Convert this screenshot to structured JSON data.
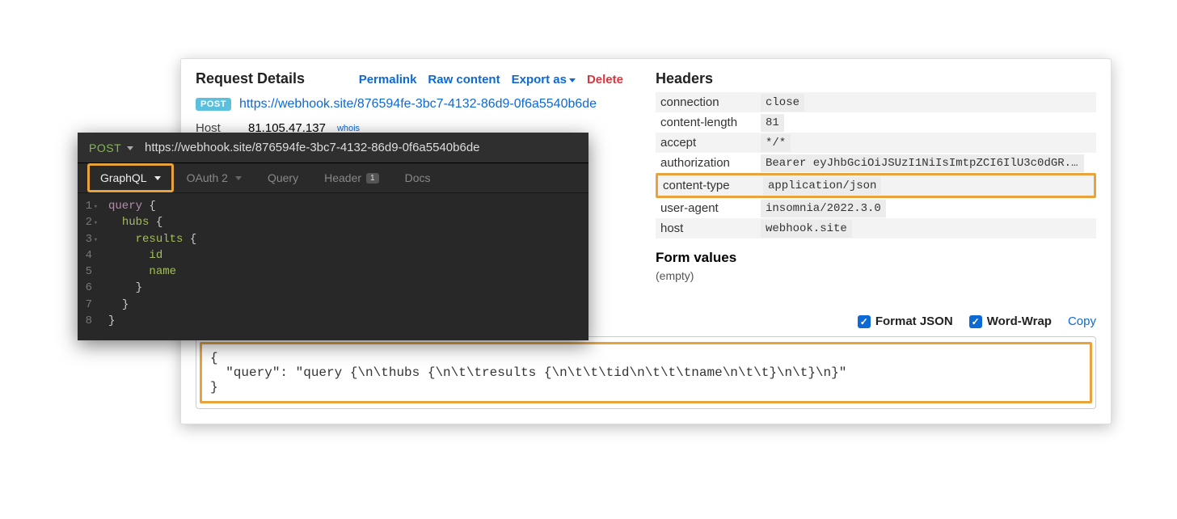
{
  "details": {
    "title": "Request Details",
    "actions": {
      "permalink": "Permalink",
      "raw": "Raw content",
      "export": "Export as",
      "delete": "Delete"
    },
    "method_badge": "POST",
    "url": "https://webhook.site/876594fe-3bc7-4132-86d9-0f6a5540b6de",
    "host_label": "Host",
    "host_value": "81.105.47.137",
    "whois": "whois"
  },
  "headers": {
    "title": "Headers",
    "rows": [
      {
        "k": "connection",
        "v": "close"
      },
      {
        "k": "content-length",
        "v": "81"
      },
      {
        "k": "accept",
        "v": "*/*"
      },
      {
        "k": "authorization",
        "v": "Bearer eyJhbGciOiJSUzI1NiIsImtpZCI6IlU3c0dGR..."
      },
      {
        "k": "content-type",
        "v": "application/json"
      },
      {
        "k": "user-agent",
        "v": "insomnia/2022.3.0"
      },
      {
        "k": "host",
        "v": "webhook.site"
      }
    ]
  },
  "form_values": {
    "title": "Form values",
    "empty": "(empty)"
  },
  "tools": {
    "format_json": "Format JSON",
    "word_wrap": "Word-Wrap",
    "copy": "Copy"
  },
  "body": {
    "line1": "{",
    "line2": "  \"query\": \"query {\\n\\thubs {\\n\\t\\tresults {\\n\\t\\t\\tid\\n\\t\\t\\tname\\n\\t\\t}\\n\\t}\\n}\"",
    "line3": "}"
  },
  "insomnia": {
    "method": "POST",
    "url": "https://webhook.site/876594fe-3bc7-4132-86d9-0f6a5540b6de",
    "tabs": {
      "graphql": "GraphQL",
      "oauth": "OAuth 2",
      "query": "Query",
      "header": "Header",
      "header_count": "1",
      "docs": "Docs"
    },
    "code": {
      "l1_kw": "query",
      "l2": "hubs",
      "l3": "results",
      "l4": "id",
      "l5": "name"
    },
    "gutter": {
      "n1": "1",
      "n2": "2",
      "n3": "3",
      "n4": "4",
      "n5": "5",
      "n6": "6",
      "n7": "7",
      "n8": "8"
    }
  }
}
